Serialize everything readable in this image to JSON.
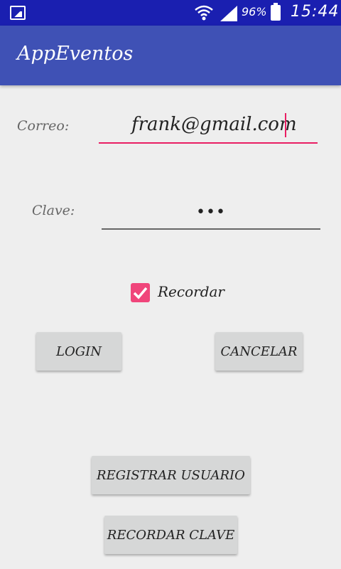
{
  "status_bar": {
    "battery_percent": "96%",
    "time": "15:44",
    "icons": [
      "image-notification-icon",
      "wifi-icon",
      "signal-icon",
      "battery-icon"
    ]
  },
  "app_bar": {
    "title": "AppEventos",
    "color": "#3f51b5"
  },
  "form": {
    "email_label": "Correo:",
    "email_value": "frank@gmail.com",
    "password_label": "Clave:",
    "password_value": "•••",
    "remember_label": "Recordar",
    "remember_checked": true,
    "accent_color": "#e91e63"
  },
  "buttons": {
    "login": "LOGIN",
    "cancel": "CANCELAR",
    "register": "REGISTRAR USUARIO",
    "remember_password": "RECORDAR CLAVE"
  }
}
